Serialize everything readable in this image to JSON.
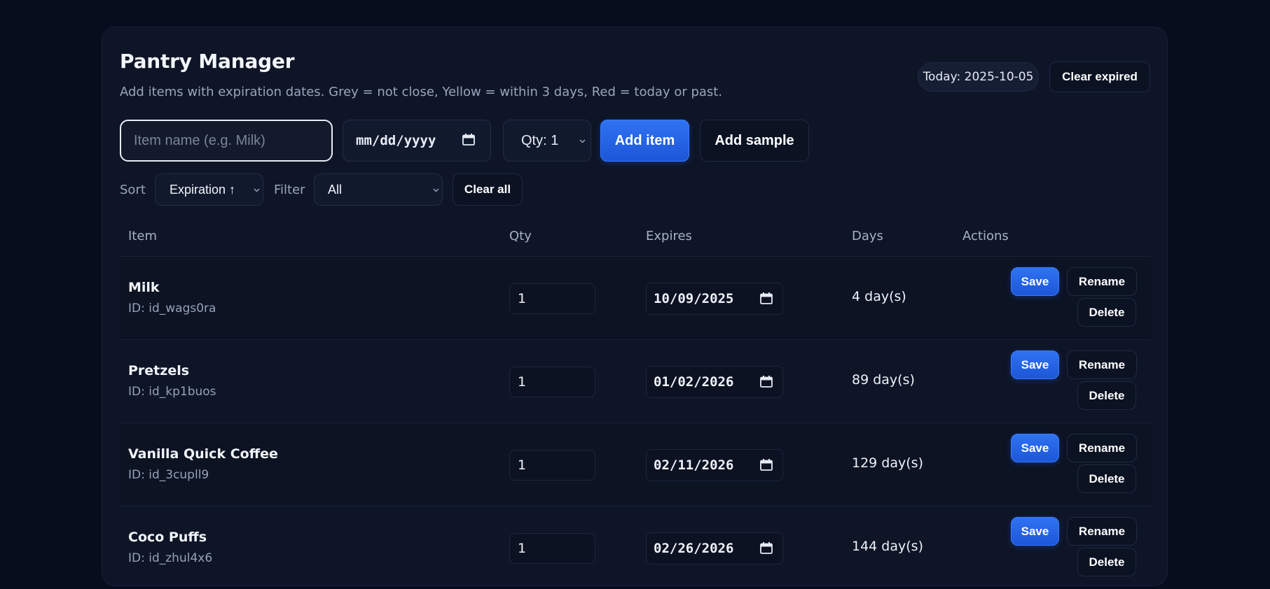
{
  "header": {
    "title": "Pantry Manager",
    "subtitle": "Add items with expiration dates. Grey = not close, Yellow = within 3 days, Red = today or past.",
    "today": "Today: 2025-10-05",
    "clear_expired_label": "Clear expired"
  },
  "add_form": {
    "item_name_placeholder": "Item name (e.g. Milk)",
    "date_placeholder": "mm/dd/yyyy",
    "qty_selected": "Qty: 1",
    "add_item_label": "Add item",
    "add_sample_label": "Add sample"
  },
  "controls": {
    "sort_label": "Sort",
    "sort_selected": "Expiration ↑",
    "filter_label": "Filter",
    "filter_selected": "All",
    "clear_all_label": "Clear all"
  },
  "table": {
    "columns": [
      "Item",
      "Qty",
      "Expires",
      "Days",
      "Actions"
    ],
    "rows": [
      {
        "name": "Milk",
        "id": "ID: id_wags0ra",
        "qty": "1",
        "expires": "10/09/2025",
        "days": "4 day(s)"
      },
      {
        "name": "Pretzels",
        "id": "ID: id_kp1buos",
        "qty": "1",
        "expires": "01/02/2026",
        "days": "89 day(s)"
      },
      {
        "name": "Vanilla Quick Coffee",
        "id": "ID: id_3cupll9",
        "qty": "1",
        "expires": "02/11/2026",
        "days": "129 day(s)"
      },
      {
        "name": "Coco Puffs",
        "id": "ID: id_zhul4x6",
        "qty": "1",
        "expires": "02/26/2026",
        "days": "144 day(s)"
      }
    ],
    "actions": {
      "save": "Save",
      "rename": "Rename",
      "delete": "Delete"
    }
  },
  "icons": {
    "date_picker": "calendar-icon",
    "select_arrow": "chevron-down-icon"
  },
  "colors": {
    "background": "#070d1d",
    "card": "#0e1526",
    "primary": "#1d56d8",
    "muted_text": "#9aa6bd"
  }
}
